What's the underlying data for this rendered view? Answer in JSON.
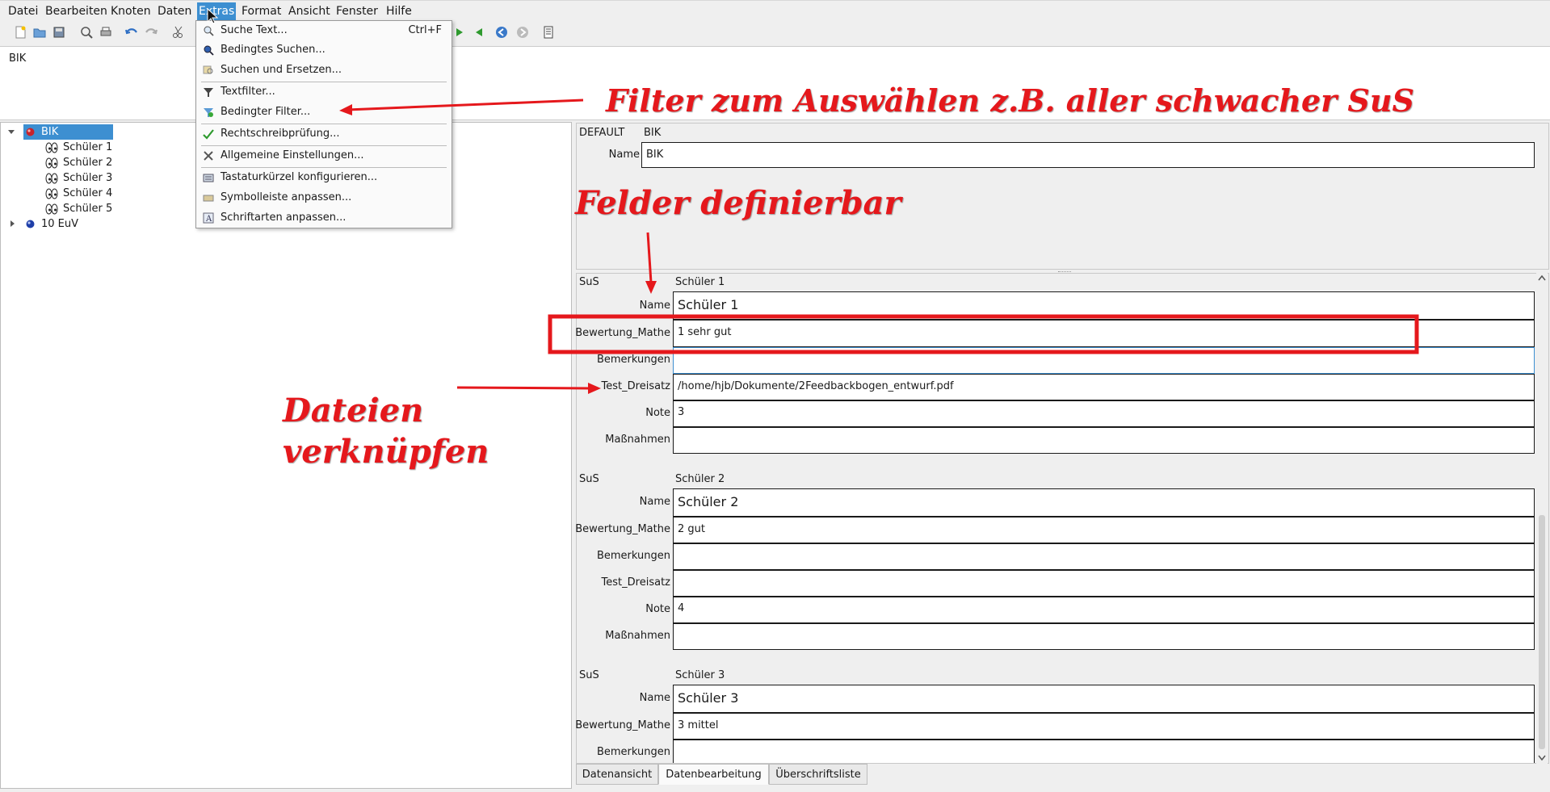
{
  "menubar": [
    "Datei",
    "Bearbeiten",
    "Knoten",
    "Daten",
    "Extras",
    "Format",
    "Ansicht",
    "Fenster",
    "Hilfe"
  ],
  "title_area": {
    "text": "BIK"
  },
  "tree": {
    "root": "BIK",
    "children": [
      "Schüler 1",
      "Schüler 2",
      "Schüler 3",
      "Schüler 4",
      "Schüler 5"
    ],
    "sibling": "10 EuV"
  },
  "dropdown": {
    "items": [
      {
        "label": "Suche Text...",
        "shortcut": "Ctrl+F",
        "icon": "search-text-icon"
      },
      {
        "label": "Bedingtes Suchen...",
        "shortcut": "",
        "icon": "magnifier-icon"
      },
      {
        "label": "Suchen und Ersetzen...",
        "shortcut": "",
        "icon": "replace-icon"
      },
      {
        "label": "Textfilter...",
        "shortcut": "",
        "icon": "funnel-icon"
      },
      {
        "label": "Bedingter Filter...",
        "shortcut": "",
        "icon": "conditional-filter-icon"
      },
      {
        "label": "Rechtschreibprüfung...",
        "shortcut": "",
        "icon": "spellcheck-icon"
      },
      {
        "label": "Allgemeine Einstellungen...",
        "shortcut": "",
        "icon": "tools-icon"
      },
      {
        "label": "Tastaturkürzel konfigurieren...",
        "shortcut": "",
        "icon": "keyboard-icon"
      },
      {
        "label": "Symbolleiste anpassen...",
        "shortcut": "",
        "icon": "toolbar-icon"
      },
      {
        "label": "Schriftarten anpassen...",
        "shortcut": "",
        "icon": "font-icon"
      }
    ]
  },
  "default_section": {
    "header_left": "DEFAULT",
    "header_right": "BIK",
    "name_label": "Name",
    "name_value": "BIK"
  },
  "records": [
    {
      "type": "SuS",
      "title": "Schüler 1",
      "fields": [
        {
          "label": "Name",
          "value": "Schüler 1"
        },
        {
          "label": "Bewertung_Mathe",
          "value": "1 sehr gut"
        },
        {
          "label": "Bemerkungen",
          "value": ""
        },
        {
          "label": "Test_Dreisatz",
          "value": "/home/hjb/Dokumente/2Feedbackbogen_entwurf.pdf"
        },
        {
          "label": "Note",
          "value": "3"
        },
        {
          "label": "Maßnahmen",
          "value": ""
        }
      ]
    },
    {
      "type": "SuS",
      "title": "Schüler 2",
      "fields": [
        {
          "label": "Name",
          "value": "Schüler 2"
        },
        {
          "label": "Bewertung_Mathe",
          "value": "2 gut"
        },
        {
          "label": "Bemerkungen",
          "value": ""
        },
        {
          "label": "Test_Dreisatz",
          "value": ""
        },
        {
          "label": "Note",
          "value": "4"
        },
        {
          "label": "Maßnahmen",
          "value": ""
        }
      ]
    },
    {
      "type": "SuS",
      "title": "Schüler 3",
      "fields": [
        {
          "label": "Name",
          "value": "Schüler 3"
        },
        {
          "label": "Bewertung_Mathe",
          "value": "3 mittel"
        },
        {
          "label": "Bemerkungen",
          "value": ""
        }
      ]
    }
  ],
  "tabs": [
    "Datenansicht",
    "Datenbearbeitung",
    "Überschriftsliste"
  ],
  "annotations": {
    "filter": "Filter zum Auswählen z.B. aller schwacher SuS",
    "fields": "Felder definierbar",
    "files_line1": "Dateien",
    "files_line2": "verknüpfen"
  },
  "colors": {
    "annotation": "#e5181c",
    "menu_active": "#3d8fd1",
    "tree_selected": "#3d8fd1"
  }
}
